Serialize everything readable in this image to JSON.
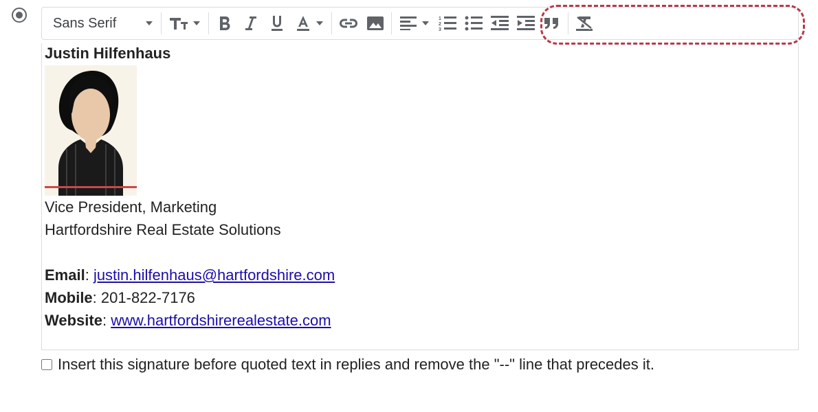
{
  "toolbar": {
    "font_family": "Sans Serif"
  },
  "signature": {
    "name": "Justin Hilfenhaus",
    "title": "Vice President, Marketing",
    "company": "Hartfordshire Real Estate Solutions",
    "email_label": "Email",
    "email_value": "justin.hilfenhaus@hartfordshire.com",
    "mobile_label": "Mobile",
    "mobile_value": "201-822-7176",
    "website_label": "Website",
    "website_value": "www.hartfordshirerealestate.com"
  },
  "checkbox_label": "Insert this signature before quoted text in replies and remove the \"--\" line that precedes it.",
  "separator_colon": ": "
}
